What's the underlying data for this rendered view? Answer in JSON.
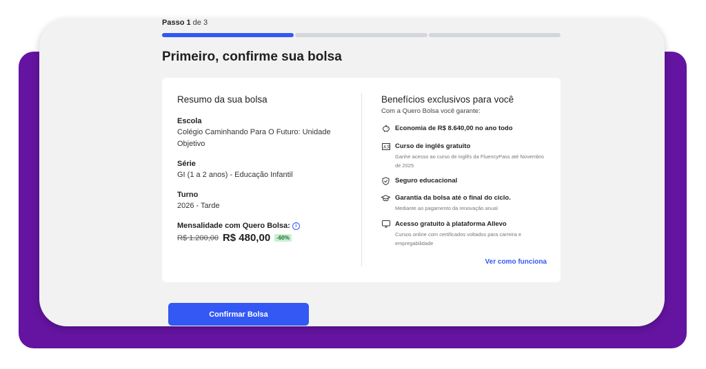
{
  "stepper": {
    "step_word": "Passo",
    "current": "1",
    "of_word": "de",
    "total": "3",
    "active_segments": 1
  },
  "page_title": "Primeiro, confirme sua bolsa",
  "summary": {
    "title": "Resumo da sua bolsa",
    "school_label": "Escola",
    "school_value": "Colégio Caminhando Para O Futuro: Unidade Objetivo",
    "grade_label": "Série",
    "grade_value": "GI (1 a 2 anos) - Educação Infantil",
    "shift_label": "Turno",
    "shift_value": "2026 - Tarde",
    "fee_label": "Mensalidade com Quero Bolsa:",
    "old_price": "R$ 1.200,00",
    "new_price": "R$ 480,00",
    "discount": "-60%"
  },
  "benefits": {
    "title": "Benefícios exclusivos para você",
    "subtitle": "Com a Quero Bolsa você garante:",
    "items": [
      {
        "icon": "piggy-bank-icon",
        "title": "Economia de R$ 8.640,00 no ano todo",
        "desc": ""
      },
      {
        "icon": "language-icon",
        "title": "Curso de inglês gratuito",
        "desc": "Ganhe acesso ao curso de inglês da FluencyPass até Novembro de 2025"
      },
      {
        "icon": "shield-check-icon",
        "title": "Seguro educacional",
        "desc": ""
      },
      {
        "icon": "graduation-cap-icon",
        "title": "Garantia da bolsa até o final do ciclo.",
        "desc": "Mediante ao pagamento da renovação anual"
      },
      {
        "icon": "monitor-icon",
        "title": "Acesso gratuito à plataforma Allevo",
        "desc": "Cursos online com certificados voltados para carreira e empregabilidade"
      }
    ],
    "link": "Ver como funciona"
  },
  "confirm_button": "Confirmar Bolsa",
  "colors": {
    "accent": "#3358f4",
    "purple": "#6414a0",
    "discount_bg": "#c9f0cf",
    "discount_text": "#176b2a"
  }
}
